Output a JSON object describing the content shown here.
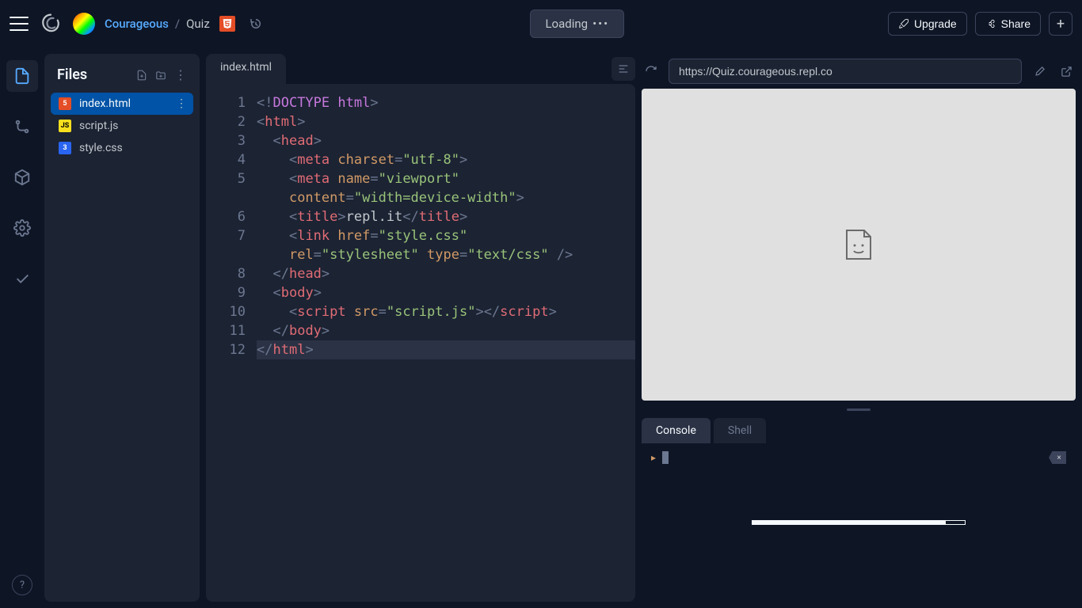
{
  "header": {
    "username": "Courageous",
    "project": "Quiz",
    "loading": "Loading",
    "upgrade": "Upgrade",
    "share": "Share"
  },
  "sidebar": {
    "rail": [
      "files",
      "vcs",
      "packages",
      "settings",
      "checks"
    ],
    "help": "?"
  },
  "files": {
    "title": "Files",
    "items": [
      {
        "name": "index.html",
        "type": "html",
        "active": true
      },
      {
        "name": "script.js",
        "type": "js",
        "active": false
      },
      {
        "name": "style.css",
        "type": "css",
        "active": false
      }
    ]
  },
  "editor": {
    "tab": "index.html",
    "lines": [
      {
        "n": 1,
        "indent": 0,
        "tokens": [
          [
            "punct",
            "<!"
          ],
          [
            "doctype",
            "DOCTYPE"
          ],
          [
            "text",
            " "
          ],
          [
            "doctype",
            "html"
          ],
          [
            "punct",
            ">"
          ]
        ]
      },
      {
        "n": 2,
        "indent": 0,
        "tokens": [
          [
            "punct",
            "<"
          ],
          [
            "tag",
            "html"
          ],
          [
            "punct",
            ">"
          ]
        ]
      },
      {
        "n": 3,
        "indent": 1,
        "tokens": [
          [
            "punct",
            "<"
          ],
          [
            "tag",
            "head"
          ],
          [
            "punct",
            ">"
          ]
        ]
      },
      {
        "n": 4,
        "indent": 2,
        "tokens": [
          [
            "punct",
            "<"
          ],
          [
            "tag",
            "meta"
          ],
          [
            "text",
            " "
          ],
          [
            "attr",
            "charset"
          ],
          [
            "punct",
            "="
          ],
          [
            "string",
            "\"utf-8\""
          ],
          [
            "punct",
            ">"
          ]
        ]
      },
      {
        "n": 5,
        "indent": 2,
        "tokens": [
          [
            "punct",
            "<"
          ],
          [
            "tag",
            "meta"
          ],
          [
            "text",
            " "
          ],
          [
            "attr",
            "name"
          ],
          [
            "punct",
            "="
          ],
          [
            "string",
            "\"viewport\""
          ],
          [
            "text",
            " "
          ]
        ]
      },
      {
        "n": null,
        "indent": 2,
        "tokens": [
          [
            "attr",
            "content"
          ],
          [
            "punct",
            "="
          ],
          [
            "string",
            "\"width=device-width\""
          ],
          [
            "punct",
            ">"
          ]
        ]
      },
      {
        "n": 6,
        "indent": 2,
        "tokens": [
          [
            "punct",
            "<"
          ],
          [
            "tag",
            "title"
          ],
          [
            "punct",
            ">"
          ],
          [
            "text",
            "repl.it"
          ],
          [
            "punct",
            "</"
          ],
          [
            "tag",
            "title"
          ],
          [
            "punct",
            ">"
          ]
        ]
      },
      {
        "n": 7,
        "indent": 2,
        "tokens": [
          [
            "punct",
            "<"
          ],
          [
            "tag",
            "link"
          ],
          [
            "text",
            " "
          ],
          [
            "attr",
            "href"
          ],
          [
            "punct",
            "="
          ],
          [
            "string",
            "\"style.css\""
          ],
          [
            "text",
            " "
          ]
        ]
      },
      {
        "n": null,
        "indent": 2,
        "tokens": [
          [
            "attr",
            "rel"
          ],
          [
            "punct",
            "="
          ],
          [
            "string",
            "\"stylesheet\""
          ],
          [
            "text",
            " "
          ],
          [
            "attr",
            "type"
          ],
          [
            "punct",
            "="
          ],
          [
            "string",
            "\"text/css\""
          ],
          [
            "text",
            " "
          ],
          [
            "punct",
            "/>"
          ]
        ]
      },
      {
        "n": 8,
        "indent": 1,
        "tokens": [
          [
            "punct",
            "</"
          ],
          [
            "tag",
            "head"
          ],
          [
            "punct",
            ">"
          ]
        ]
      },
      {
        "n": 9,
        "indent": 1,
        "tokens": [
          [
            "punct",
            "<"
          ],
          [
            "tag",
            "body"
          ],
          [
            "punct",
            ">"
          ]
        ]
      },
      {
        "n": 10,
        "indent": 2,
        "tokens": [
          [
            "punct",
            "<"
          ],
          [
            "tag",
            "script"
          ],
          [
            "text",
            " "
          ],
          [
            "attr",
            "src"
          ],
          [
            "punct",
            "="
          ],
          [
            "string",
            "\"script.js\""
          ],
          [
            "punct",
            ">"
          ],
          [
            "punct",
            "</"
          ],
          [
            "tag",
            "script"
          ],
          [
            "punct",
            ">"
          ]
        ]
      },
      {
        "n": 11,
        "indent": 1,
        "tokens": [
          [
            "punct",
            "</"
          ],
          [
            "tag",
            "body"
          ],
          [
            "punct",
            ">"
          ]
        ]
      },
      {
        "n": 12,
        "indent": 0,
        "current": true,
        "tokens": [
          [
            "punct",
            "</"
          ],
          [
            "tag",
            "html"
          ],
          [
            "punct",
            ">"
          ]
        ]
      }
    ]
  },
  "preview": {
    "url": "https://Quiz.courageous.repl.co"
  },
  "console": {
    "tabs": [
      {
        "label": "Console",
        "active": true
      },
      {
        "label": "Shell",
        "active": false
      }
    ],
    "clear": "×"
  }
}
